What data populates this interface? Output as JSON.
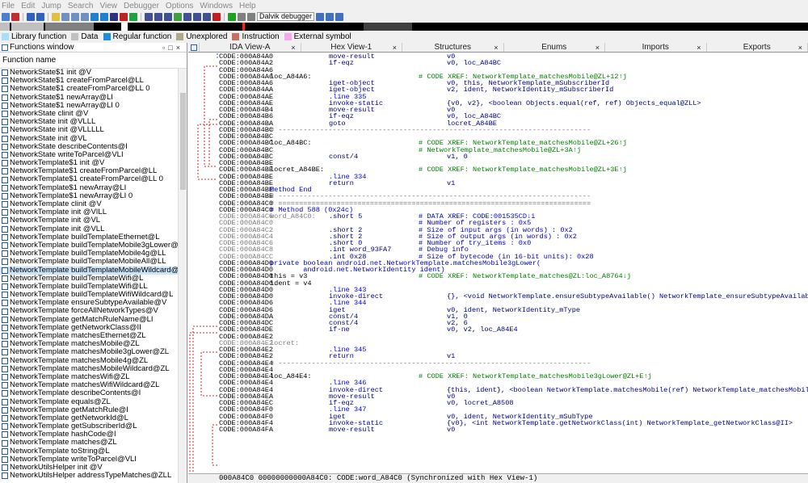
{
  "menu": [
    "File",
    "Edit",
    "Jump",
    "Search",
    "View",
    "Debugger",
    "Options",
    "Windows",
    "Help"
  ],
  "toolbar": {
    "debugger_select": "Dalvik debugger"
  },
  "legend": [
    {
      "label": "Library function",
      "color": "#a8e0f8"
    },
    {
      "label": "Data",
      "color": "#c0c0c0"
    },
    {
      "label": "Regular function",
      "color": "#1a8fe0"
    },
    {
      "label": "Unexplored",
      "color": "#b0a88a"
    },
    {
      "label": "Instruction",
      "color": "#c87060"
    },
    {
      "label": "External symbol",
      "color": "#f8a8f0"
    }
  ],
  "functions_window": {
    "title": "Functions window",
    "header": "Function name",
    "items": [
      "NetworkState$1  init @V",
      "NetworkState$1 createFromParcel@LL",
      "NetworkState$1 createFromParcel@LL 0",
      "NetworkState$1 newArray@LI",
      "NetworkState$1 newArray@LI 0",
      "NetworkState  clinit @V",
      "NetworkState  init @VLLL",
      "NetworkState  init @VLLLLL",
      "NetworkState  init @VL",
      "NetworkState describeContents@I",
      "NetworkState writeToParcel@VLI",
      "NetworkTemplate$1  init @V",
      "NetworkTemplate$1 createFromParcel@LL",
      "NetworkTemplate$1 createFromParcel@LL 0",
      "NetworkTemplate$1 newArray@LI",
      "NetworkTemplate$1 newArray@LI 0",
      "NetworkTemplate  clinit @V",
      "NetworkTemplate  init @VILL",
      "NetworkTemplate  init @VL",
      "NetworkTemplate  init @VLL",
      "NetworkTemplate buildTemplateEthernet@L",
      "NetworkTemplate buildTemplateMobile3gLower@LL",
      "NetworkTemplate buildTemplateMobile4g@LL",
      "NetworkTemplate buildTemplateMobileAll@LL",
      "NetworkTemplate buildTemplateMobileWildcard@L",
      "NetworkTemplate buildTemplateWifi@L",
      "NetworkTemplate buildTemplateWifi@LL",
      "NetworkTemplate buildTemplateWifiWildcard@L",
      "NetworkTemplate ensureSubtypeAvailable@V",
      "NetworkTemplate forceAllNetworkTypes@V",
      "NetworkTemplate getMatchRuleName@LI",
      "NetworkTemplate getNetworkClass@II",
      "NetworkTemplate matchesEthernet@ZL",
      "NetworkTemplate matchesMobile@ZL",
      "NetworkTemplate matchesMobile3gLower@ZL",
      "NetworkTemplate matchesMobile4g@ZL",
      "NetworkTemplate matchesMobileWildcard@ZL",
      "NetworkTemplate matchesWifi@ZL",
      "NetworkTemplate matchesWifiWildcard@ZL",
      "NetworkTemplate describeContents@I",
      "NetworkTemplate equals@ZL",
      "NetworkTemplate getMatchRule@I",
      "NetworkTemplate getNetworkId@L",
      "NetworkTemplate getSubscriberId@L",
      "NetworkTemplate hashCode@I",
      "NetworkTemplate matches@ZL",
      "NetworkTemplate toString@L",
      "NetworkTemplate writeToParcel@VLI",
      "NetworkUtilsHelper  init @V",
      "NetworkUtilsHelper addressTypeMatches@ZLL"
    ],
    "selected_index": 24
  },
  "tabs": [
    {
      "label": "IDA View-A",
      "closable": true
    },
    {
      "label": "Hex View-1",
      "closable": true
    },
    {
      "label": "Structures",
      "closable": true
    },
    {
      "label": "Enums",
      "closable": true
    },
    {
      "label": "Imports",
      "closable": true
    },
    {
      "label": "Exports",
      "closable": true
    }
  ],
  "code_lines": [
    {
      "a": "CODE:000A84A0",
      "m": "move-result",
      "o": "v0"
    },
    {
      "a": "CODE:000A84A2",
      "m": "if-eqz",
      "o": "v0, loc_A84BC"
    },
    {
      "a": "CODE:000A84A6"
    },
    {
      "a": "CODE:000A84A6",
      "l": "loc_A84A6:",
      "c": "# CODE XREF: NetworkTemplate_matchesMobile@ZL+12↑j"
    },
    {
      "a": "CODE:000A84A6",
      "m": "iget-object",
      "o": "v0, this, NetworkTemplate_mSubscriberId"
    },
    {
      "a": "CODE:000A84AA",
      "m": "iget-object",
      "o": "v2, ident, NetworkIdentity_mSubscriberId"
    },
    {
      "a": "CODE:000A84AE",
      "m": ".line 335",
      "dir": true
    },
    {
      "a": "CODE:000A84AE",
      "m": "invoke-static",
      "o": "{v0, v2}, <boolean Objects.equal(ref, ref) Objects_equal@ZLL>"
    },
    {
      "a": "CODE:000A84B4",
      "m": "move-result",
      "o": "v0"
    },
    {
      "a": "CODE:000A84B6",
      "m": "if-eqz",
      "o": "v0, loc_A84BC"
    },
    {
      "a": "CODE:000A84BA",
      "m": "goto",
      "o": "locret_A84BE"
    },
    {
      "a": "CODE:000A84BC",
      "c2": "# ---------------------------------------------------------------------------"
    },
    {
      "a": "CODE:000A84BC"
    },
    {
      "a": "CODE:000A84BC",
      "l": "loc_A84BC:",
      "c": "# CODE XREF: NetworkTemplate_matchesMobile@ZL+26↑j"
    },
    {
      "a": "CODE:000A84BC",
      "c": "# NetworkTemplate_matchesMobile@ZL+3A↑j"
    },
    {
      "a": "CODE:000A84BC",
      "m": "const/4",
      "o": "v1, 0"
    },
    {
      "a": "CODE:000A84BE"
    },
    {
      "a": "CODE:000A84BE",
      "l": "locret_A84BE:",
      "c": "# CODE XREF: NetworkTemplate_matchesMobile@ZL+3E↑j"
    },
    {
      "a": "CODE:000A84BE",
      "m": ".line 334",
      "dir": true
    },
    {
      "a": "CODE:000A84BE",
      "m": "return",
      "o": "v1"
    },
    {
      "a": "CODE:000A84BE",
      "l": "Method End",
      "bl": true
    },
    {
      "a": "CODE:000A84BE",
      "c2": "# ---------------------------------------------------------------------------"
    },
    {
      "a": "CODE:000A84C0",
      "c2": "# ==========================================================================="
    },
    {
      "a": "CODE:000A84C0",
      "c2": "# Method 588 (0x24c)",
      "blue": true
    },
    {
      "a": "CODE:000A84C0",
      "l": "word_A84C0:",
      "m": ".short 5",
      "c": "# DATA XREF: CODE:001535CD↓i",
      "g": true
    },
    {
      "a": "CODE:000A84C0",
      "c": "# Number of registers : 0x5",
      "g": true
    },
    {
      "a": "CODE:000A84C2",
      "m": ".short 2",
      "c": "# Size of input args (in words) : 0x2",
      "g": true
    },
    {
      "a": "CODE:000A84C4",
      "m": ".short 2",
      "c": "# Size of output args (in words) : 0x2",
      "g": true
    },
    {
      "a": "CODE:000A84C6",
      "m": ".short 0",
      "c": "# Number of try_items : 0x0",
      "g": true
    },
    {
      "a": "CODE:000A84C8",
      "m": ".int word_93FA7",
      "c": "# Debug info",
      "g": true
    },
    {
      "a": "CODE:000A84CC",
      "m": ".int 0x28",
      "c": "# Size of bytecode (in 16-bit units): 0x28",
      "g": true
    },
    {
      "a": "CODE:000A84D0",
      "l": "private boolean android.net.NetworkTemplate.matchesMobile3gLower(",
      "bl": true
    },
    {
      "a": "CODE:000A84D0",
      "l": "        android.net.NetworkIdentity ident)",
      "bl": true
    },
    {
      "a": "CODE:000A84D0",
      "l": "this = v3",
      "c": "# CODE XREF: NetworkTemplate_matches@ZL:loc_A8764↓j"
    },
    {
      "a": "CODE:000A84D0",
      "l": "ident = v4"
    },
    {
      "a": "CODE:000A84D0",
      "m": ".line 343",
      "dir": true
    },
    {
      "a": "CODE:000A84D0",
      "m": "invoke-direct",
      "o": "{}, <void NetworkTemplate.ensureSubtypeAvailable() NetworkTemplate_ensureSubtypeAvailable@V>"
    },
    {
      "a": "CODE:000A84D6",
      "m": ".line 344",
      "dir": true
    },
    {
      "a": "CODE:000A84D6",
      "m": "iget",
      "o": "v0, ident, NetworkIdentity_mType"
    },
    {
      "a": "CODE:000A84DA",
      "m": "const/4",
      "o": "v1, 0"
    },
    {
      "a": "CODE:000A84DC",
      "m": "const/4",
      "o": "v2, 6"
    },
    {
      "a": "CODE:000A84DE",
      "m": "if-ne",
      "o": "v0, v2, loc_A84E4"
    },
    {
      "a": "CODE:000A84E2"
    },
    {
      "a": "CODE:000A84E2",
      "l": "locret:",
      "g": true
    },
    {
      "a": "CODE:000A84E2",
      "m": ".line 345",
      "dir": true
    },
    {
      "a": "CODE:000A84E2",
      "m": "return",
      "o": "v1"
    },
    {
      "a": "CODE:000A84E4",
      "c2": "# ---------------------------------------------------------------------------"
    },
    {
      "a": "CODE:000A84E4"
    },
    {
      "a": "CODE:000A84E4",
      "l": "loc_A84E4:",
      "c": "# CODE XREF: NetworkTemplate_matchesMobile3gLower@ZL+E↑j"
    },
    {
      "a": "CODE:000A84E4",
      "m": ".line 346",
      "dir": true
    },
    {
      "a": "CODE:000A84E4",
      "m": "invoke-direct",
      "o": "{this, ident}, <boolean NetworkTemplate.matchesMobile(ref) NetworkTemplate_matchesMobile@ZL>"
    },
    {
      "a": "CODE:000A84EA",
      "m": "move-result",
      "o": "v0"
    },
    {
      "a": "CODE:000A84EC",
      "m": "if-eqz",
      "o": "v0, locret_A8508"
    },
    {
      "a": "CODE:000A84F0",
      "m": ".line 347",
      "dir": true
    },
    {
      "a": "CODE:000A84F0",
      "m": "iget",
      "o": "v0, ident, NetworkIdentity_mSubType"
    },
    {
      "a": "CODE:000A84F4",
      "m": "invoke-static",
      "o": "{v0}, <int NetworkTemplate.getNetworkClass(int) NetworkTemplate_getNetworkClass@II>"
    },
    {
      "a": "CODE:000A84FA",
      "m": "move-result",
      "o": "v0"
    }
  ],
  "status_bar": "000A84C0 00000000000A84C0: CODE:word_A84C0 (Synchronized with Hex View-1)"
}
